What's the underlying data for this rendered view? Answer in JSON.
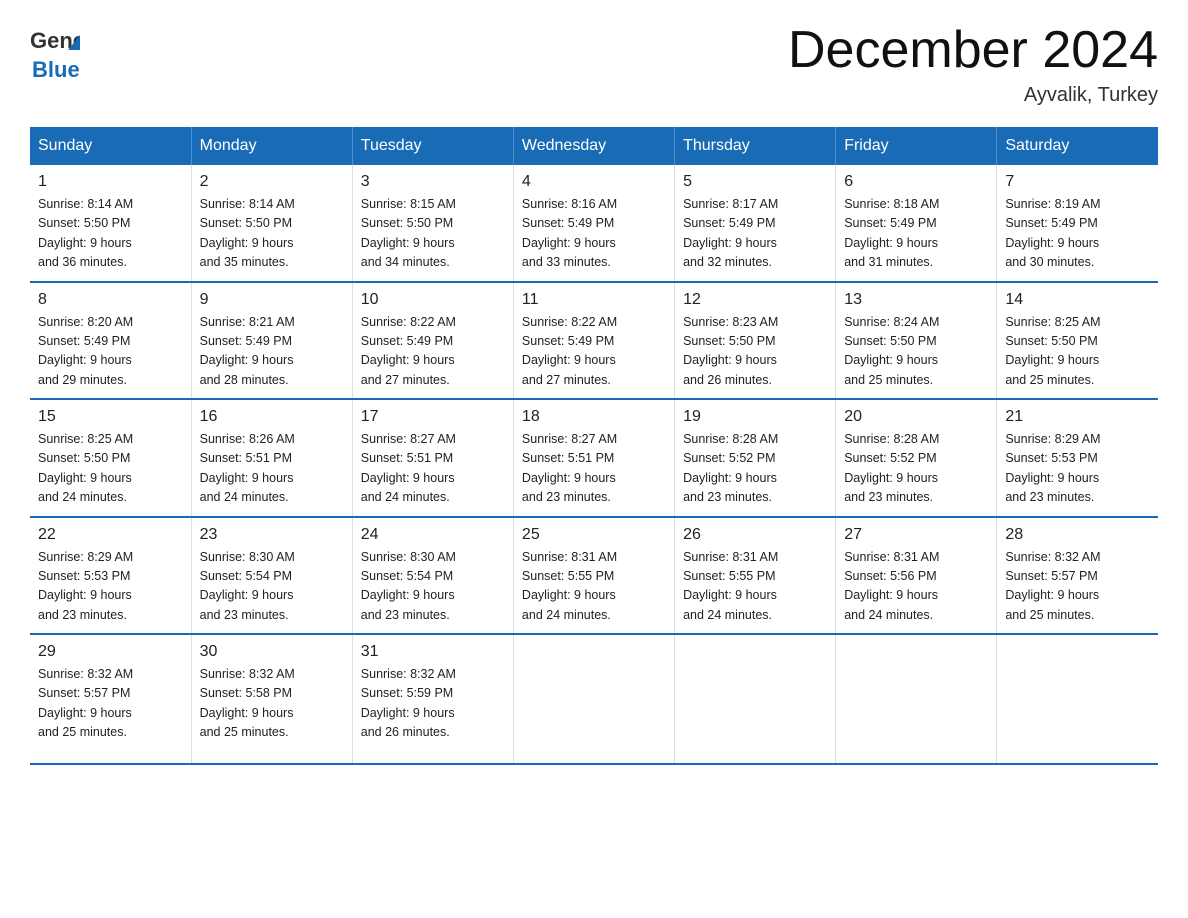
{
  "header": {
    "logo_general": "General",
    "logo_blue": "Blue",
    "month_title": "December 2024",
    "location": "Ayvalik, Turkey"
  },
  "weekdays": [
    "Sunday",
    "Monday",
    "Tuesday",
    "Wednesday",
    "Thursday",
    "Friday",
    "Saturday"
  ],
  "weeks": [
    [
      {
        "day": "1",
        "sunrise": "8:14 AM",
        "sunset": "5:50 PM",
        "daylight": "9 hours and 36 minutes."
      },
      {
        "day": "2",
        "sunrise": "8:14 AM",
        "sunset": "5:50 PM",
        "daylight": "9 hours and 35 minutes."
      },
      {
        "day": "3",
        "sunrise": "8:15 AM",
        "sunset": "5:50 PM",
        "daylight": "9 hours and 34 minutes."
      },
      {
        "day": "4",
        "sunrise": "8:16 AM",
        "sunset": "5:49 PM",
        "daylight": "9 hours and 33 minutes."
      },
      {
        "day": "5",
        "sunrise": "8:17 AM",
        "sunset": "5:49 PM",
        "daylight": "9 hours and 32 minutes."
      },
      {
        "day": "6",
        "sunrise": "8:18 AM",
        "sunset": "5:49 PM",
        "daylight": "9 hours and 31 minutes."
      },
      {
        "day": "7",
        "sunrise": "8:19 AM",
        "sunset": "5:49 PM",
        "daylight": "9 hours and 30 minutes."
      }
    ],
    [
      {
        "day": "8",
        "sunrise": "8:20 AM",
        "sunset": "5:49 PM",
        "daylight": "9 hours and 29 minutes."
      },
      {
        "day": "9",
        "sunrise": "8:21 AM",
        "sunset": "5:49 PM",
        "daylight": "9 hours and 28 minutes."
      },
      {
        "day": "10",
        "sunrise": "8:22 AM",
        "sunset": "5:49 PM",
        "daylight": "9 hours and 27 minutes."
      },
      {
        "day": "11",
        "sunrise": "8:22 AM",
        "sunset": "5:49 PM",
        "daylight": "9 hours and 27 minutes."
      },
      {
        "day": "12",
        "sunrise": "8:23 AM",
        "sunset": "5:50 PM",
        "daylight": "9 hours and 26 minutes."
      },
      {
        "day": "13",
        "sunrise": "8:24 AM",
        "sunset": "5:50 PM",
        "daylight": "9 hours and 25 minutes."
      },
      {
        "day": "14",
        "sunrise": "8:25 AM",
        "sunset": "5:50 PM",
        "daylight": "9 hours and 25 minutes."
      }
    ],
    [
      {
        "day": "15",
        "sunrise": "8:25 AM",
        "sunset": "5:50 PM",
        "daylight": "9 hours and 24 minutes."
      },
      {
        "day": "16",
        "sunrise": "8:26 AM",
        "sunset": "5:51 PM",
        "daylight": "9 hours and 24 minutes."
      },
      {
        "day": "17",
        "sunrise": "8:27 AM",
        "sunset": "5:51 PM",
        "daylight": "9 hours and 24 minutes."
      },
      {
        "day": "18",
        "sunrise": "8:27 AM",
        "sunset": "5:51 PM",
        "daylight": "9 hours and 23 minutes."
      },
      {
        "day": "19",
        "sunrise": "8:28 AM",
        "sunset": "5:52 PM",
        "daylight": "9 hours and 23 minutes."
      },
      {
        "day": "20",
        "sunrise": "8:28 AM",
        "sunset": "5:52 PM",
        "daylight": "9 hours and 23 minutes."
      },
      {
        "day": "21",
        "sunrise": "8:29 AM",
        "sunset": "5:53 PM",
        "daylight": "9 hours and 23 minutes."
      }
    ],
    [
      {
        "day": "22",
        "sunrise": "8:29 AM",
        "sunset": "5:53 PM",
        "daylight": "9 hours and 23 minutes."
      },
      {
        "day": "23",
        "sunrise": "8:30 AM",
        "sunset": "5:54 PM",
        "daylight": "9 hours and 23 minutes."
      },
      {
        "day": "24",
        "sunrise": "8:30 AM",
        "sunset": "5:54 PM",
        "daylight": "9 hours and 23 minutes."
      },
      {
        "day": "25",
        "sunrise": "8:31 AM",
        "sunset": "5:55 PM",
        "daylight": "9 hours and 24 minutes."
      },
      {
        "day": "26",
        "sunrise": "8:31 AM",
        "sunset": "5:55 PM",
        "daylight": "9 hours and 24 minutes."
      },
      {
        "day": "27",
        "sunrise": "8:31 AM",
        "sunset": "5:56 PM",
        "daylight": "9 hours and 24 minutes."
      },
      {
        "day": "28",
        "sunrise": "8:32 AM",
        "sunset": "5:57 PM",
        "daylight": "9 hours and 25 minutes."
      }
    ],
    [
      {
        "day": "29",
        "sunrise": "8:32 AM",
        "sunset": "5:57 PM",
        "daylight": "9 hours and 25 minutes."
      },
      {
        "day": "30",
        "sunrise": "8:32 AM",
        "sunset": "5:58 PM",
        "daylight": "9 hours and 25 minutes."
      },
      {
        "day": "31",
        "sunrise": "8:32 AM",
        "sunset": "5:59 PM",
        "daylight": "9 hours and 26 minutes."
      },
      null,
      null,
      null,
      null
    ]
  ]
}
